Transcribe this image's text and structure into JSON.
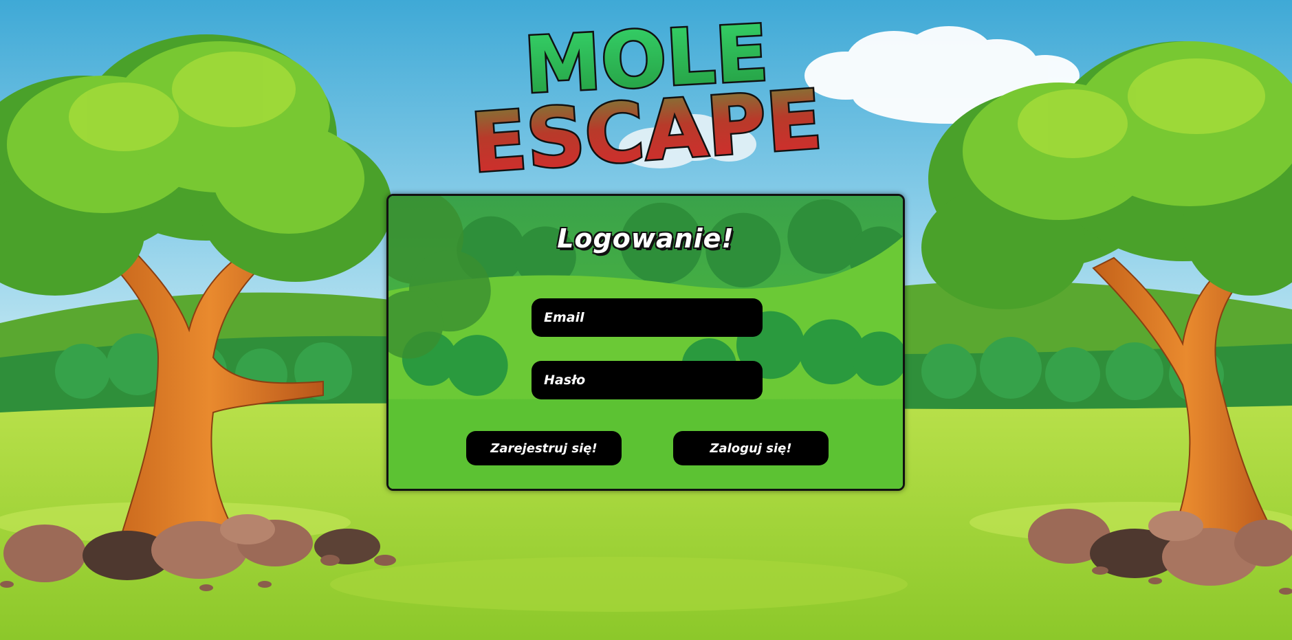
{
  "game": {
    "logo_line1": "MOLE",
    "logo_line2": "ESCAPE"
  },
  "login_panel": {
    "title": "Logowanie!",
    "email_placeholder": "Email",
    "password_placeholder": "Hasło",
    "register_label": "Zarejestruj się!",
    "login_label": "Zaloguj się!"
  },
  "colors": {
    "sky_top": "#3fa9d6",
    "sky_bottom": "#bfe6f0",
    "grass": "#8fcf2a",
    "panel_green": "#4cb944",
    "logo_green": "#2bbf4f",
    "logo_red": "#d3262a",
    "button_black": "#000000"
  }
}
